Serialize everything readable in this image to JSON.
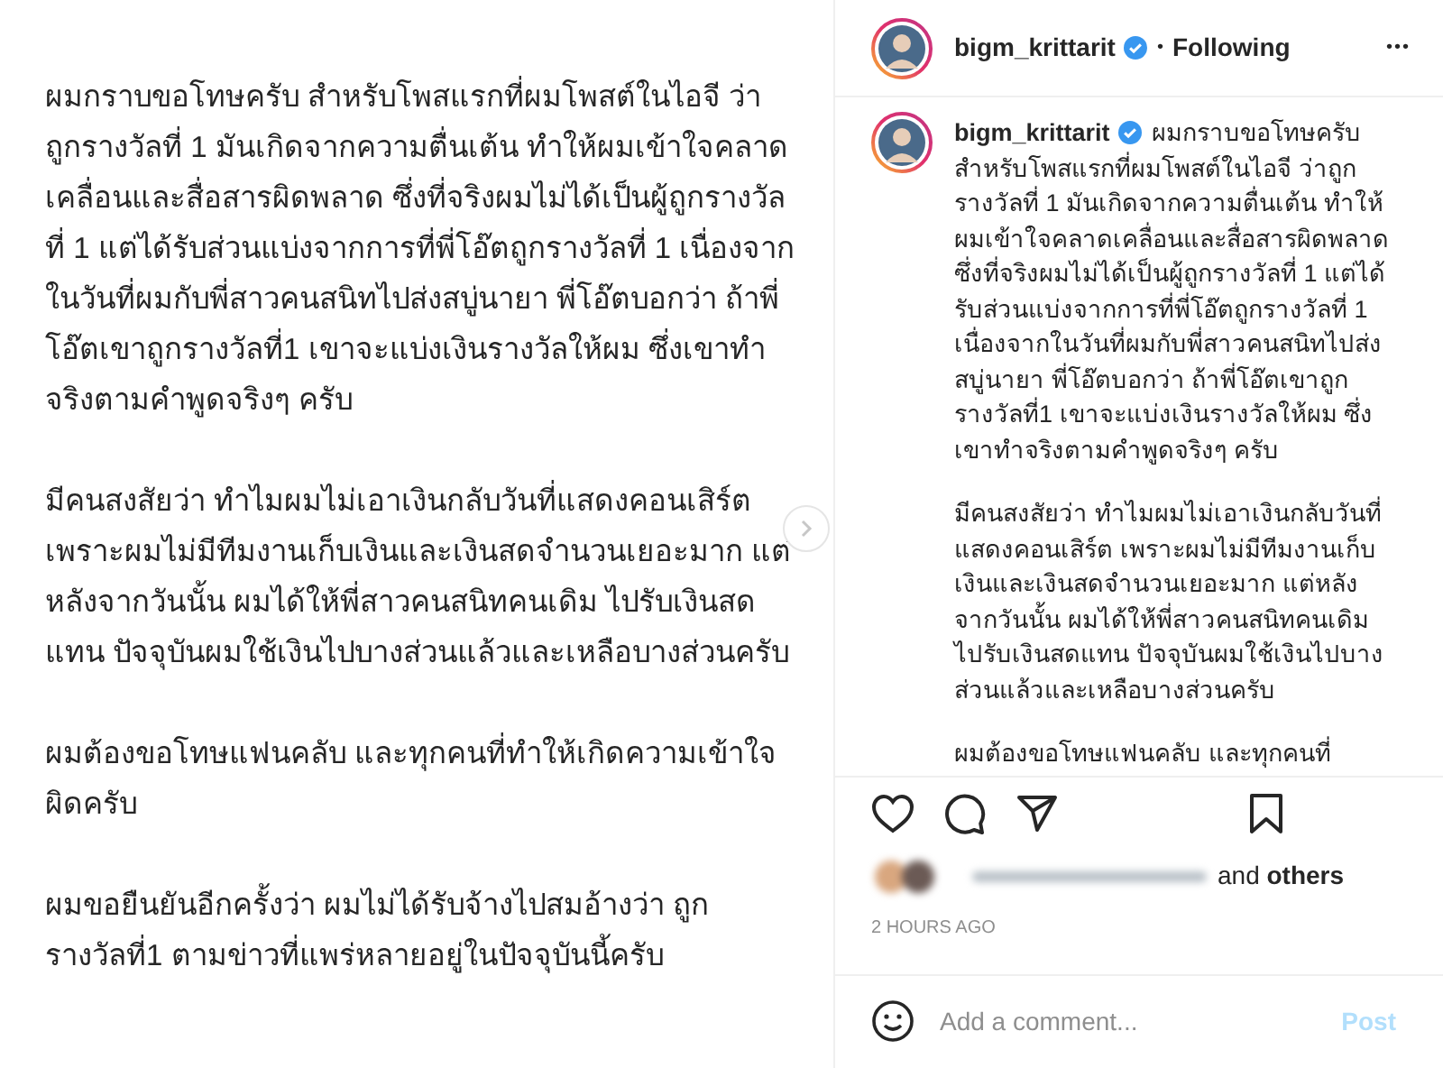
{
  "post_image": {
    "paragraphs": [
      [
        "ผมกราบขอโทษครับ สำหรับโพสแรกที่ผมโพสต์ในไอจี ว่า",
        "ถูกรางวัลที่ 1 มันเกิดจากความตื่นเต้น ทำให้ผมเข้าใจคลาด",
        "เคลื่อนและสื่อสารผิดพลาด ซึ่งที่จริงผมไม่ได้เป็นผู้ถูกรางวัล",
        "ที่ 1 แต่ได้รับส่วนแบ่งจากการที่พี่โอ๊ตถูกรางวัลที่ 1 เนื่องจาก",
        "ในวันที่ผมกับพี่สาวคนสนิทไปส่งสบู่นายา พี่โอ๊ตบอกว่า ถ้าพี่",
        "โอ๊ตเขาถูกรางวัลที่1 เขาจะแบ่งเงินรางวัลให้ผม ซึ่งเขาทำ",
        "จริงตามคำพูดจริงๆ ครับ"
      ],
      [
        "มีคนสงสัยว่า ทำไมผมไม่เอาเงินกลับวันที่แสดงคอนเสิร์ต",
        "เพราะผมไม่มีทีมงานเก็บเงินและเงินสดจำนวนเยอะมาก แต่",
        "หลังจากวันนั้น ผมได้ให้พี่สาวคนสนิทคนเดิม ไปรับเงินสด",
        "แทน ปัจจุบันผมใช้เงินไปบางส่วนแล้วและเหลือบางส่วนครับ"
      ],
      [
        "ผมต้องขอโทษแฟนคลับ และทุกคนที่ทำให้เกิดความเข้าใจ",
        "ผิดครับ"
      ],
      [
        "ผมขอยืนยันอีกครั้งว่า ผมไม่ได้รับจ้างไปสมอ้างว่า ถูก",
        "รางวัลที่1 ตามข่าวที่แพร่หลายอยู่ในปัจจุบันนี้ครับ"
      ]
    ]
  },
  "header": {
    "username": "bigm_krittarit",
    "verified": true,
    "separator": "•",
    "follow_status": "Following",
    "more": "•••"
  },
  "caption": {
    "username": "bigm_krittarit",
    "verified": true,
    "paragraphs": [
      [
        "ผมกราบขอโทษครับ",
        "สำหรับโพสแรกที่ผมโพสต์ในไอจี ว่าถูก",
        "รางวัลที่ 1 มันเกิดจากความตื่นเต้น ทำให้",
        "ผมเข้าใจคลาดเคลื่อนและสื่อสารผิดพลาด",
        "ซึ่งที่จริงผมไม่ได้เป็นผู้ถูกรางวัลที่ 1 แต่ได้",
        "รับส่วนแบ่งจากการที่พี่โอ๊ตถูกรางวัลที่ 1",
        "เนื่องจากในวันที่ผมกับพี่สาวคนสนิทไปส่ง",
        "สบู่นายา พี่โอ๊ตบอกว่า ถ้าพี่โอ๊ตเขาถูก",
        "รางวัลที่1 เขาจะแบ่งเงินรางวัลให้ผม ซึ่ง",
        "เขาทำจริงตามคำพูดจริงๆ ครับ"
      ],
      [
        "มีคนสงสัยว่า ทำไมผมไม่เอาเงินกลับวันที่",
        "แสดงคอนเสิร์ต เพราะผมไม่มีทีมงานเก็บ",
        "เงินและเงินสดจำนวนเยอะมาก แต่หลัง",
        "จากวันนั้น ผมได้ให้พี่สาวคนสนิทคนเดิม",
        "ไปรับเงินสดแทน ปัจจุบันผมใช้เงินไปบาง",
        "ส่วนแล้วและเหลือบางส่วนครับ"
      ],
      [
        "ผมต้องขอโทษแฟนคลับ และทุกคนที่"
      ]
    ]
  },
  "likes": {
    "suffix_word": "and",
    "suffix_bold": "others"
  },
  "time": "2 HOURS AGO",
  "comment": {
    "placeholder": "Add a comment...",
    "post_button": "Post",
    "disabled": true
  }
}
